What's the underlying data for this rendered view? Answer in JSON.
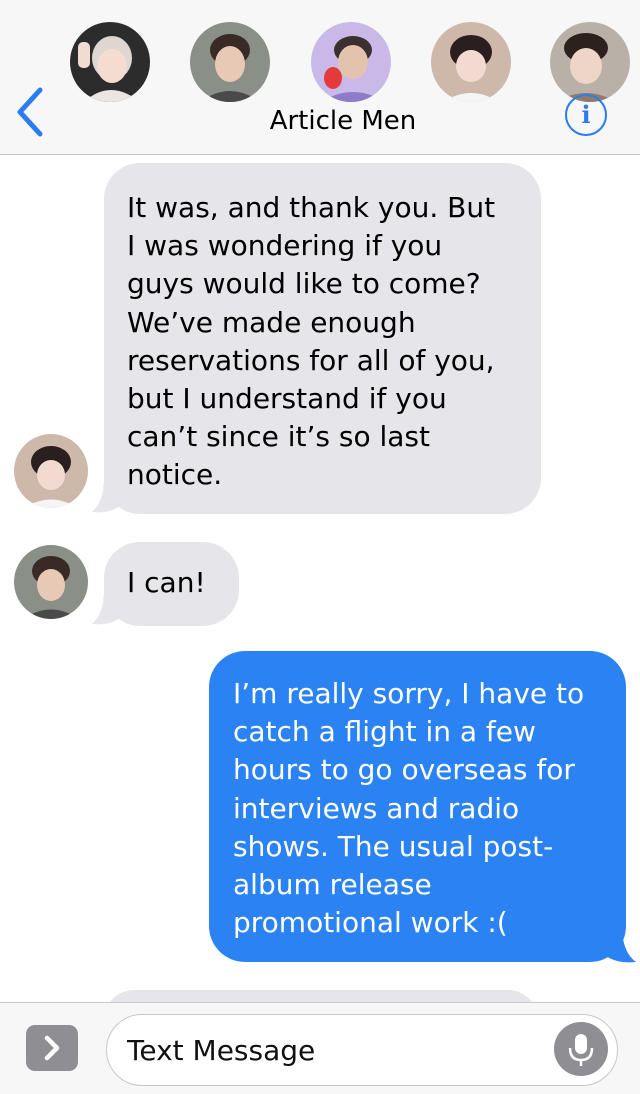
{
  "header": {
    "title": "Article Men",
    "info_label": "i",
    "participants": [
      {
        "name": "avatar-1",
        "bg": "#2c2c2c",
        "skin": "#f4dcd0",
        "hair": "#ded6d0"
      },
      {
        "name": "avatar-2",
        "bg": "#8a8f88",
        "skin": "#e8c9b6",
        "hair": "#3a2a25"
      },
      {
        "name": "avatar-3",
        "bg": "#c9b9e8",
        "skin": "#e3c3ad",
        "hair": "#3b3030"
      },
      {
        "name": "avatar-4",
        "bg": "#cdb8aa",
        "skin": "#f2dad0",
        "hair": "#2a1f1e"
      },
      {
        "name": "avatar-5",
        "bg": "#b9b1a8",
        "skin": "#efd5c8",
        "hair": "#2d211d"
      }
    ]
  },
  "messages": [
    {
      "direction": "incoming",
      "text": "It was, and thank you. But\nI was wondering if you\nguys would like to come?\nWe’ve made enough\nreservations for all of you,\nbut I understand if you\ncan’t since it’s so last\nnotice."
    },
    {
      "direction": "incoming",
      "text": "I can!"
    },
    {
      "direction": "outgoing",
      "text": "I’m really sorry, I have to\ncatch a flight in a few\nhours to go overseas for\ninterviews and radio\nshows. The usual post-\nalbum release\npromotional work :("
    }
  ],
  "composer": {
    "placeholder": "Text Message"
  },
  "colors": {
    "accent": "#2a7cf0",
    "incoming_bubble": "#e5e5ea",
    "outgoing_bubble": "#2b83f3"
  },
  "icons": [
    "chevron-left-icon",
    "info-icon",
    "app-store-chevron-icon",
    "microphone-icon"
  ]
}
